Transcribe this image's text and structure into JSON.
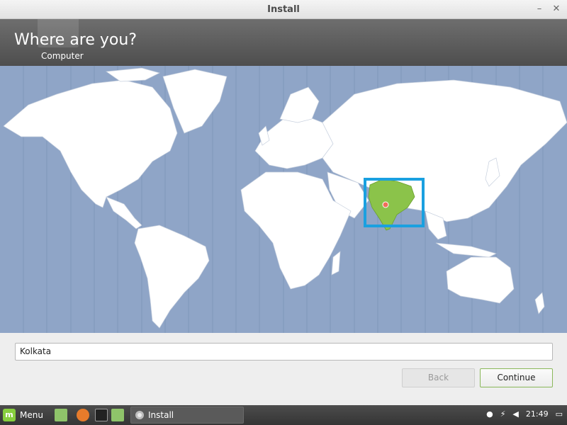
{
  "window": {
    "title": "Install"
  },
  "header": {
    "title": "Where are you?",
    "subtitle": "Computer"
  },
  "map": {
    "selected_region": "India",
    "highlight_color": "#1aa0e0",
    "ocean_color": "#8fa5c7",
    "land_color": "#ffffff",
    "selected_color": "#8bc34a"
  },
  "location": {
    "value": "Kolkata"
  },
  "buttons": {
    "back": "Back",
    "continue": "Continue"
  },
  "taskbar": {
    "menu_label": "Menu",
    "task_label": "Install",
    "clock": "21:49"
  }
}
